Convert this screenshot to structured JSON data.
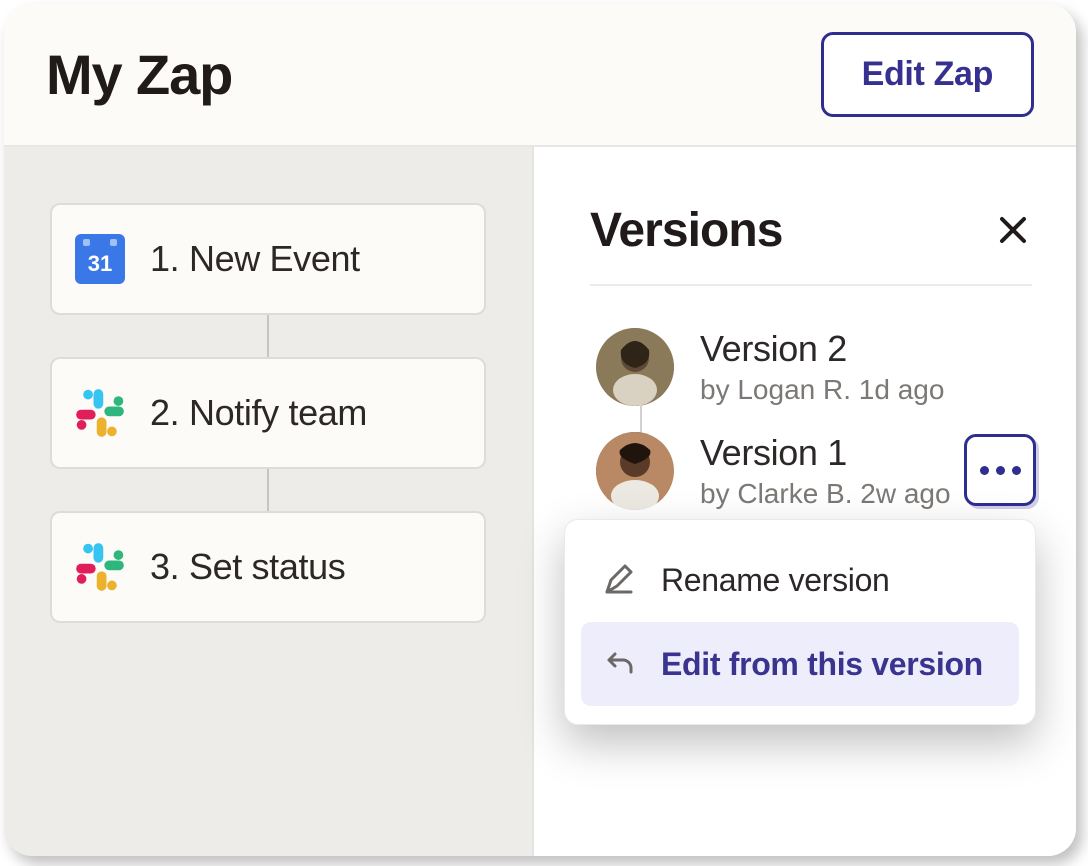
{
  "header": {
    "title": "My Zap",
    "edit_button_label": "Edit Zap"
  },
  "steps": [
    {
      "icon": "google-calendar",
      "label": "1. New Event"
    },
    {
      "icon": "slack",
      "label": "2. Notify team"
    },
    {
      "icon": "slack",
      "label": "3. Set status"
    }
  ],
  "versions_panel": {
    "title": "Versions",
    "close_icon": "close-icon"
  },
  "versions": [
    {
      "name": "Version 2",
      "byline": "by Logan R. 1d ago",
      "avatar": "avatar-1"
    },
    {
      "name": "Version 1",
      "byline": "by Clarke B. 2w ago",
      "avatar": "avatar-2"
    }
  ],
  "version_menu": {
    "rename_label": "Rename version",
    "edit_from_label": "Edit from this version"
  },
  "colors": {
    "accent": "#2f2d8f",
    "panel_bg": "#fdfbf8",
    "canvas_bg": "#eeece9"
  },
  "gcal_day": "31"
}
